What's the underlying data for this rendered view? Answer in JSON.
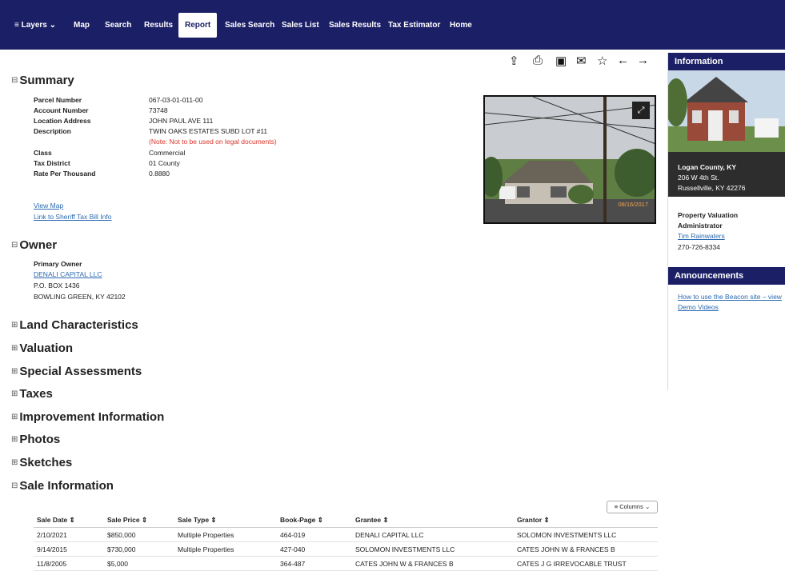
{
  "nav": {
    "layers": "≡ Layers ⌄",
    "items": [
      "Map",
      "Search",
      "Results",
      "Report",
      "Sales Search",
      "Sales List",
      "Sales Results",
      "Tax Estimator",
      "Home"
    ]
  },
  "toolbar_icons": [
    "share-icon",
    "print-icon",
    "image-icon",
    "email-icon",
    "star-icon",
    "arrow-left-icon",
    "arrow-right-icon"
  ],
  "summary": {
    "title": "Summary",
    "rows": [
      {
        "label": "Parcel Number",
        "value": "067-03-01-011-00"
      },
      {
        "label": "Account Number",
        "value": "73748"
      },
      {
        "label": "Location Address",
        "value": "JOHN PAUL AVE 111"
      },
      {
        "label": "Description",
        "value": "TWIN OAKS ESTATES SUBD LOT #11"
      },
      {
        "label": "",
        "value": "(Note: Not to be used on legal documents)"
      },
      {
        "label": "Class",
        "value": "Commercial"
      },
      {
        "label": "Tax District",
        "value": "01 County"
      },
      {
        "label": "Rate Per Thousand",
        "value": "0.8880"
      }
    ],
    "links": [
      "View Map",
      "Link to Sheriff Tax Bill Info"
    ],
    "photo_date": "08/16/2017"
  },
  "owner": {
    "title": "Owner",
    "label": "Primary Owner",
    "name": "DENALI CAPITAL LLC",
    "address1": "P.O. BOX 1436",
    "address2": "BOWLING GREEN, KY 42102"
  },
  "collapsed_sections": [
    "Land Characteristics",
    "Valuation",
    "Special Assessments",
    "Taxes",
    "Improvement Information",
    "Photos",
    "Sketches"
  ],
  "sale": {
    "title": "Sale Information",
    "columns_button": "Columns",
    "headers": [
      "Sale Date ⇕",
      "Sale Price ⇕",
      "Sale Type ⇕",
      "Book-Page ⇕",
      "Grantee ⇕",
      "Grantor ⇕"
    ],
    "rows": [
      [
        "2/10/2021",
        "$850,000",
        "Multiple Properties",
        "464-019",
        "DENALI CAPITAL LLC",
        "SOLOMON INVESTMENTS LLC"
      ],
      [
        "9/14/2015",
        "$730,000",
        "Multiple Properties",
        "427-040",
        "SOLOMON INVESTMENTS LLC",
        "CATES JOHN W & FRANCES B"
      ],
      [
        "11/8/2005",
        "$5,000",
        "",
        "364-487",
        "CATES JOHN W & FRANCES B",
        "CATES J G IRREVOCABLE TRUST"
      ]
    ]
  },
  "sidebar": {
    "info_title": "Information",
    "county": "Logan County, KY",
    "street": "206 W 4th St.",
    "city": "Russellville, KY 42276",
    "pva_line1": "Property Valuation",
    "pva_line2": "Administrator",
    "pva_name": "Tim Rainwaters",
    "phone": "270-726-8334",
    "ann_title": "Announcements",
    "ann_link1": "How to use the Beacon site – view",
    "ann_link2": "Demo Videos"
  }
}
